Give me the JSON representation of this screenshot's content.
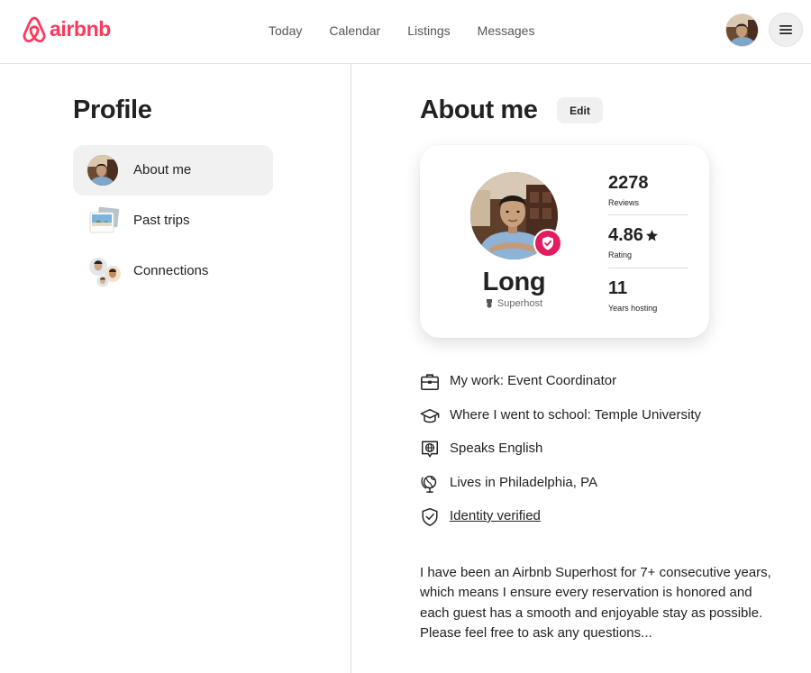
{
  "brand": {
    "name": "airbnb",
    "color": "#FF385C"
  },
  "nav": {
    "items": [
      "Today",
      "Calendar",
      "Listings",
      "Messages"
    ]
  },
  "header": {
    "avatar_icon": "user-avatar",
    "menu_icon": "hamburger-menu-icon"
  },
  "sidebar": {
    "title": "Profile",
    "items": [
      {
        "label": "About me",
        "icon": "user-avatar",
        "active": true
      },
      {
        "label": "Past trips",
        "icon": "photo-stack-icon",
        "active": false
      },
      {
        "label": "Connections",
        "icon": "people-icon",
        "active": false
      }
    ]
  },
  "about": {
    "title": "About me",
    "edit_label": "Edit"
  },
  "card": {
    "name": "Long",
    "role": "Superhost",
    "badge_color": "#E31C5F",
    "stats": [
      {
        "value": "2278",
        "label": "Reviews"
      },
      {
        "value": "4.86",
        "label": "Rating",
        "icon": "star-icon"
      },
      {
        "value": "11",
        "label": "Years hosting"
      }
    ]
  },
  "facts": [
    {
      "icon": "briefcase-icon",
      "text": "My work: Event Coordinator"
    },
    {
      "icon": "graduation-cap-icon",
      "text": "Where I went to school: Temple University"
    },
    {
      "icon": "speech-globe-icon",
      "text": "Speaks English"
    },
    {
      "icon": "globe-icon",
      "text": "Lives in Philadelphia, PA"
    },
    {
      "icon": "shield-check-icon",
      "text": "Identity verified",
      "link": true
    }
  ],
  "bio": "I have been an Airbnb Superhost for 7+ consecutive years, which means I ensure every reservation is honored and each guest has a smooth and enjoyable stay as possible.  Please feel free to ask any questions..."
}
